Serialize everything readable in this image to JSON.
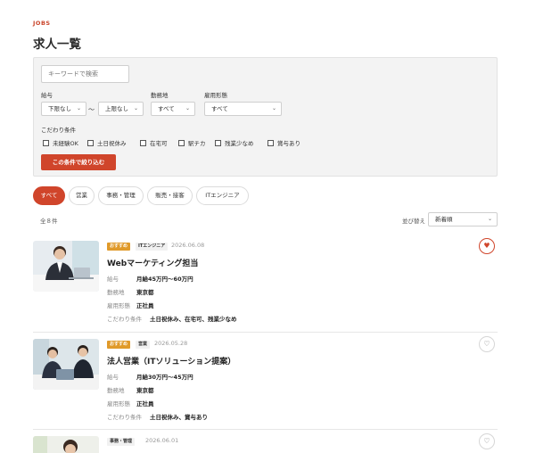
{
  "header": {
    "eyebrow": "JOBS",
    "title": "求人一覧"
  },
  "filter": {
    "keyword_placeholder": "キーワードで検索",
    "salary_label": "給与",
    "salary_min": "下限なし",
    "salary_tilde": "〜",
    "salary_max": "上限なし",
    "location_label": "勤務地",
    "location_value": "すべて",
    "employment_label": "雇用形態",
    "employment_value": "すべて",
    "conditions_label": "こだわり条件",
    "conditions": [
      "未経験OK",
      "土日祝休み",
      "在宅可",
      "駅チカ",
      "残業少なめ",
      "賞与あり"
    ],
    "apply_label": "この条件で絞り込む"
  },
  "tabs": [
    "すべて",
    "営業",
    "事務・管理",
    "販売・接客",
    "ITエンジニア"
  ],
  "results": {
    "count": "全８件",
    "sort_label": "並び替え",
    "sort_value": "新着順"
  },
  "jobs": [
    {
      "recommended": "おすすめ",
      "category": "ITエンジニア",
      "date": "2026.06.08",
      "title": "Webマーケティング担当",
      "rows": [
        {
          "k": "給与",
          "v": "月給45万円〜60万円"
        },
        {
          "k": "勤務地",
          "v": "東京都"
        },
        {
          "k": "雇用形態",
          "v": "正社員"
        },
        {
          "k": "こだわり条件",
          "v": "土日祝休み、在宅可、残業少なめ"
        }
      ],
      "favorite": true
    },
    {
      "recommended": "おすすめ",
      "category": "営業",
      "date": "2026.05.28",
      "title": "法人営業（ITソリューション提案）",
      "rows": [
        {
          "k": "給与",
          "v": "月給30万円〜45万円"
        },
        {
          "k": "勤務地",
          "v": "東京都"
        },
        {
          "k": "雇用形態",
          "v": "正社員"
        },
        {
          "k": "こだわり条件",
          "v": "土日祝休み、賞与あり"
        }
      ],
      "favorite": false
    },
    {
      "category": "事務・管理",
      "date": "2026.06.01",
      "favorite": false
    }
  ],
  "colors": {
    "accent": "#d0452b",
    "badge": "#e09a2a"
  },
  "icons": {
    "favorite": "heart-icon",
    "dropdown": "chevron-down-icon"
  }
}
